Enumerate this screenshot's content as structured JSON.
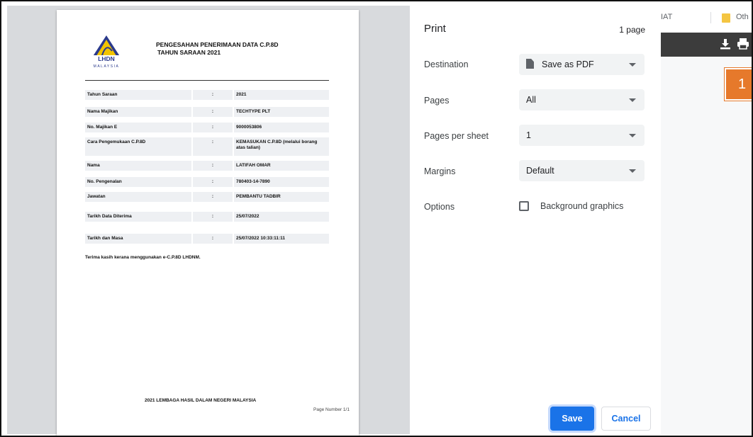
{
  "document": {
    "logo_text": "LHDN",
    "logo_subtext": "MALAYSIA",
    "title_line1": "PENGESAHAN PENERIMAAN DATA C.P.8D",
    "title_line2": "TAHUN SARAAN 2021",
    "rows": [
      {
        "label": "Tahun Saraan",
        "colon": ":",
        "value": "2021"
      },
      {
        "label": "Nama Majikan",
        "colon": ":",
        "value": "TECHTYPE PLT"
      },
      {
        "label": "No. Majikan E",
        "colon": ":",
        "value": "9000053806"
      },
      {
        "label": "Cara Pengemukaan C.P.8D",
        "colon": ":",
        "value": "KEMASUKAN C.P.8D (melalui borang atas talian)"
      },
      {
        "label": "Nama",
        "colon": ":",
        "value": "LATIFAH OMAR"
      },
      {
        "label": "No. Pengenalan",
        "colon": ":",
        "value": "780403-14-7890"
      },
      {
        "label": "Jawatan",
        "colon": ":",
        "value": "PEMBANTU TADBIR"
      },
      {
        "label": "Tarikh Data Diterima",
        "colon": ":",
        "value": "25/07/2022"
      },
      {
        "label": "Tarikh dan Masa",
        "colon": ":",
        "value": "25/07/2022 10:33:11:11"
      }
    ],
    "thanks": "Terima kasih kerana menggunakan e-C.P.8D LHDNM.",
    "footer": "2021 LEMBAGA HASIL DALAM NEGERI MALAYSIA",
    "page_number": "Page Number 1/1"
  },
  "print": {
    "title": "Print",
    "page_count": "1 page",
    "destination_label": "Destination",
    "destination_value": "Save as PDF",
    "pages_label": "Pages",
    "pages_value": "All",
    "pps_label": "Pages per sheet",
    "pps_value": "1",
    "margins_label": "Margins",
    "margins_value": "Default",
    "options_label": "Options",
    "bg_graphics_label": "Background graphics",
    "bg_graphics_checked": false,
    "save_label": "Save",
    "cancel_label": "Cancel"
  },
  "browser": {
    "bookmark_partial_1": "IAT",
    "bookmark_partial_2": "Oth"
  },
  "annotation": {
    "step": "1",
    "color": "#e6792b"
  },
  "colors": {
    "accent": "#1a73e8",
    "toolbar": "#3c3c3c"
  }
}
